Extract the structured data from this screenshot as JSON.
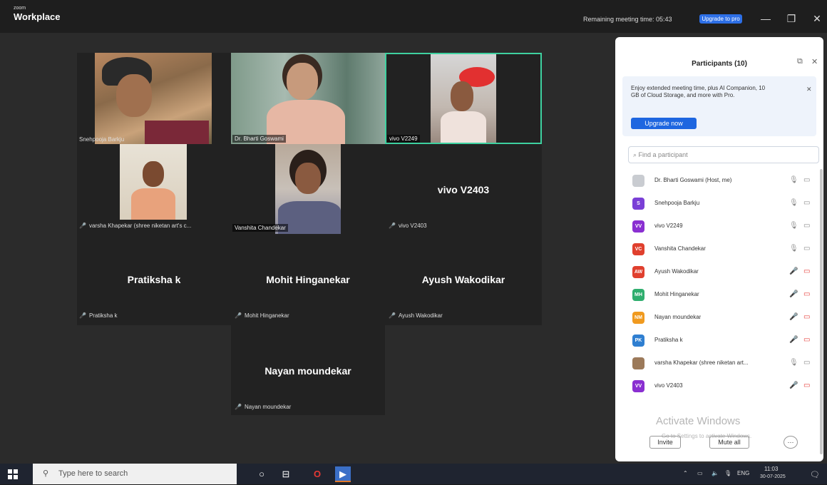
{
  "titlebar": {
    "brand_small": "zoom",
    "brand_big": "Workplace",
    "remaining_text": "Remaining meeting time: 05:43",
    "upgrade_label": "Upgrade to pro"
  },
  "tiles": {
    "snehpooja": {
      "tag": "Snehpooja Barkju"
    },
    "bharti": {
      "tag": "Dr. Bharti Goswami"
    },
    "vivo2249": {
      "tag": "vivo V2249"
    },
    "varsha": {
      "tag": "varsha Khapekar (shree niketan art's c..."
    },
    "vanshita": {
      "tag": "Vanshita Chandekar"
    },
    "vivo2403": {
      "big": "vivo V2403",
      "tag": "vivo V2403"
    },
    "pratiksha": {
      "big": "Pratiksha k",
      "tag": "Pratiksha k"
    },
    "mohit": {
      "big": "Mohit Hinganekar",
      "tag": "Mohit Hinganekar"
    },
    "ayush": {
      "big": "Ayush Wakodikar",
      "tag": "Ayush Wakodikar"
    },
    "nayan": {
      "big": "Nayan moundekar",
      "tag": "Nayan moundekar"
    }
  },
  "panel": {
    "title": "Participants (10)",
    "promo_text": "Enjoy extended meeting time, plus AI Companion, 10 GB of Cloud Storage, and more with Pro.",
    "promo_button": "Upgrade now",
    "search_placeholder": "Find a participant",
    "participants": [
      {
        "name": "Dr. Bharti Goswami (Host, me)",
        "initials": "",
        "color": "#c9ccd1",
        "muted": false
      },
      {
        "name": "Snehpooja Barkju",
        "initials": "S",
        "color": "#7a3fd6",
        "muted": false
      },
      {
        "name": "vivo V2249",
        "initials": "VV",
        "color": "#8a2fd1",
        "muted": false
      },
      {
        "name": "Vanshita Chandekar",
        "initials": "VC",
        "color": "#e0402e",
        "muted": false
      },
      {
        "name": "Ayush Wakodikar",
        "initials": "AW",
        "color": "#e0402e",
        "muted": true
      },
      {
        "name": "Mohit Hinganekar",
        "initials": "MH",
        "color": "#2fae6e",
        "muted": true
      },
      {
        "name": "Nayan moundekar",
        "initials": "NM",
        "color": "#f09a1f",
        "muted": true
      },
      {
        "name": "Pratiksha k",
        "initials": "PK",
        "color": "#2f7fd1",
        "muted": true
      },
      {
        "name": "varsha Khapekar (shree niketan art...",
        "initials": "",
        "color": "#9c7a5a",
        "muted": false
      },
      {
        "name": "vivo V2403",
        "initials": "VV",
        "color": "#8a2fd1",
        "muted": true
      }
    ],
    "invite_label": "Invite",
    "mute_all_label": "Mute all",
    "more_label": "···"
  },
  "watermark": {
    "line1": "Activate Windows",
    "line2": "Go to Settings to activate Windows."
  },
  "taskbar": {
    "search_text": "Type here to search",
    "lang": "ENG",
    "time": "11:03",
    "date": "30-07-2025"
  }
}
